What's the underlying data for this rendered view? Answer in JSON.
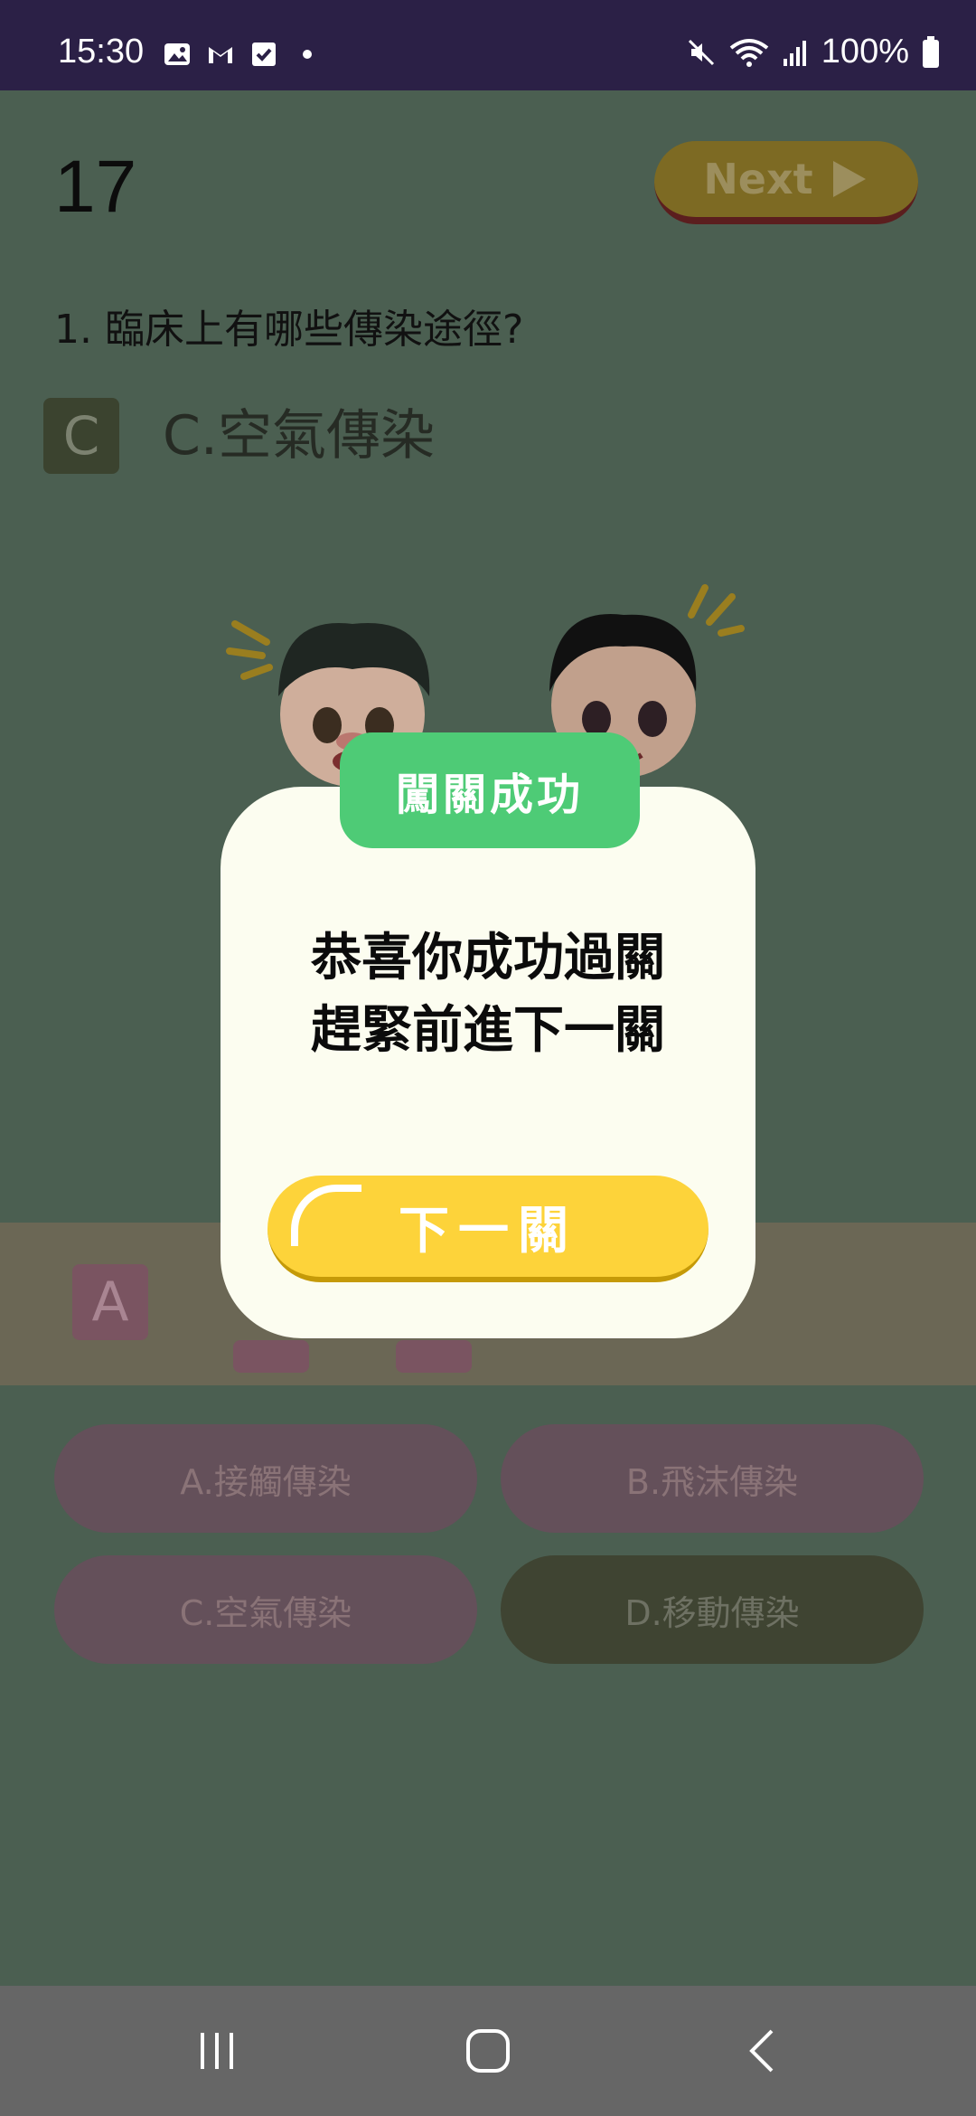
{
  "status_bar": {
    "time": "15:30",
    "left_icons": [
      "gallery-icon",
      "gmail-icon",
      "check-icon",
      "dot-icon"
    ],
    "right_icons": [
      "mute-icon",
      "wifi-icon",
      "signal-icon"
    ],
    "battery": "100%"
  },
  "game": {
    "level_number": "17",
    "next_label": "Next",
    "question": "1. 臨床上有哪些傳染途徑?",
    "selected_letter": "C",
    "selected_answer": "C.空氣傳染",
    "strip_letters": [
      "A"
    ]
  },
  "options": [
    {
      "label": "A.接觸傳染"
    },
    {
      "label": "B.飛沫傳染"
    },
    {
      "label": "C.空氣傳染"
    },
    {
      "label": "D.移動傳染"
    }
  ],
  "modal": {
    "tab_title": "闖關成功",
    "message_line1": "恭喜你成功過關",
    "message_line2": "趕緊前進下一關",
    "button_label": "下一關"
  },
  "colors": {
    "status_bar": "#2b2046",
    "dim_background": "#4b5f51",
    "modal_bg": "#fcfdf0",
    "tab_green": "#4ecb76",
    "button_yellow": "#fdd33a",
    "navbar": "#666666"
  }
}
